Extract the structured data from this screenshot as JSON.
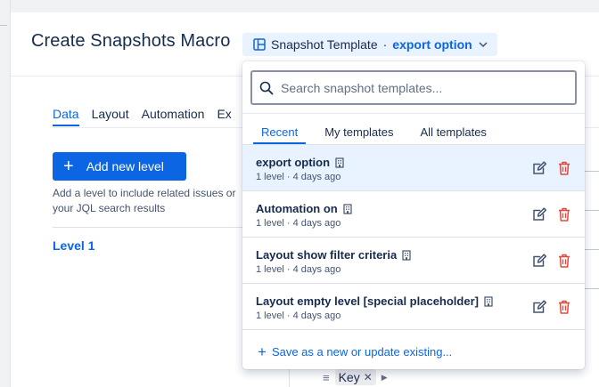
{
  "modal": {
    "title": "Create Snapshots Macro"
  },
  "template_button": {
    "prefix": "Snapshot Template",
    "separator": "·",
    "current": "export option"
  },
  "tabs": [
    {
      "label": "Data",
      "active": true
    },
    {
      "label": "Layout",
      "active": false
    },
    {
      "label": "Automation",
      "active": false
    },
    {
      "label": "Ex",
      "active": false
    }
  ],
  "add_level": {
    "icon": "+",
    "label": "Add new level"
  },
  "help_text": "Add a level to include related issues or your JQL search results",
  "level": {
    "label": "Level 1"
  },
  "field_chip": {
    "drag_icon": "≡",
    "label": "Key",
    "remove_icon": "✕",
    "caret": "▶"
  },
  "dropdown": {
    "search": {
      "placeholder": "Search snapshot templates..."
    },
    "tabs": [
      {
        "label": "Recent",
        "active": true
      },
      {
        "label": "My templates",
        "active": false
      },
      {
        "label": "All templates",
        "active": false
      }
    ],
    "items": [
      {
        "name": "export option",
        "meta": "1 level · 4 days ago",
        "selected": true
      },
      {
        "name": "Automation on",
        "meta": "1 level · 4 days ago",
        "selected": false
      },
      {
        "name": "Layout show filter criteria",
        "meta": "1 level · 4 days ago",
        "selected": false
      },
      {
        "name": "Layout empty level [special placeholder]",
        "meta": "1 level · 4 days ago",
        "selected": false
      }
    ],
    "save": {
      "icon": "+",
      "label": "Save as a new or update existing..."
    }
  },
  "colors": {
    "accent": "#0c66e4",
    "danger": "#e2483d",
    "selected_bg": "#e9f2ff"
  }
}
